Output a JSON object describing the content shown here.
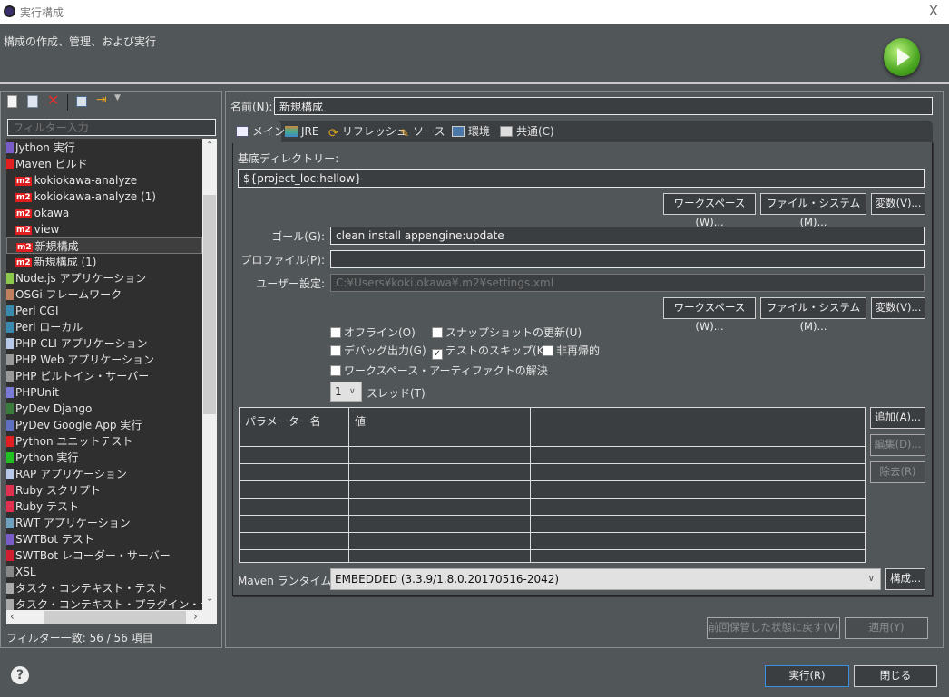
{
  "window": {
    "title": "実行構成",
    "close": "X"
  },
  "header": {
    "description": "構成の作成、管理、および実行"
  },
  "left": {
    "filter_placeholder": "フィルター入力",
    "items": [
      {
        "label": "Jython 実行",
        "type": "category",
        "icon": "jython-icon"
      },
      {
        "label": "Maven ビルド",
        "type": "category",
        "icon": "maven-icon"
      },
      {
        "label": "kokiokawa-analyze",
        "type": "child"
      },
      {
        "label": "kokiokawa-analyze (1)",
        "type": "child"
      },
      {
        "label": "okawa",
        "type": "child"
      },
      {
        "label": "view",
        "type": "child"
      },
      {
        "label": "新規構成",
        "type": "child",
        "selected": true
      },
      {
        "label": "新規構成 (1)",
        "type": "child"
      },
      {
        "label": "Node.js アプリケーション",
        "type": "category",
        "icon": "nodejs-icon"
      },
      {
        "label": "OSGi フレームワーク",
        "type": "category",
        "icon": "osgi-icon"
      },
      {
        "label": "Perl CGI",
        "type": "category",
        "icon": "perl-cgi-icon"
      },
      {
        "label": "Perl ローカル",
        "type": "category",
        "icon": "perl-icon"
      },
      {
        "label": "PHP CLI アプリケーション",
        "type": "category",
        "icon": "php-icon"
      },
      {
        "label": "PHP Web アプリケーション",
        "type": "category",
        "icon": "php-web-icon"
      },
      {
        "label": "PHP ビルトイン・サーバー",
        "type": "category",
        "icon": "php-server-icon"
      },
      {
        "label": "PHPUnit",
        "type": "category",
        "icon": "phpunit-icon"
      },
      {
        "label": "PyDev Django",
        "type": "category",
        "icon": "django-icon"
      },
      {
        "label": "PyDev Google App 実行",
        "type": "category",
        "icon": "google-app-icon"
      },
      {
        "label": "Python ユニットテスト",
        "type": "category",
        "icon": "python-unittest-icon"
      },
      {
        "label": "Python 実行",
        "type": "category",
        "icon": "python-icon"
      },
      {
        "label": "RAP アプリケーション",
        "type": "category",
        "icon": "rap-icon"
      },
      {
        "label": "Ruby スクリプト",
        "type": "category",
        "icon": "ruby-icon"
      },
      {
        "label": "Ruby テスト",
        "type": "category",
        "icon": "ruby-test-icon"
      },
      {
        "label": "RWT アプリケーション",
        "type": "category",
        "icon": "rwt-icon"
      },
      {
        "label": "SWTBot テスト",
        "type": "category",
        "icon": "swtbot-icon"
      },
      {
        "label": "SWTBot レコーダー・サーバー",
        "type": "category",
        "icon": "swtbot-recorder-icon"
      },
      {
        "label": "XSL",
        "type": "category",
        "icon": "xsl-icon"
      },
      {
        "label": "タスク・コンテキスト・テスト",
        "type": "category",
        "icon": "task-icon"
      },
      {
        "label": "タスク・コンテキスト・プラグイン・テスト",
        "type": "category",
        "icon": "task-plugin-icon"
      }
    ],
    "status": "フィルター一致: 56 / 56 項目"
  },
  "form": {
    "name_label": "名前(N):",
    "name_value": "新規構成",
    "tabs": [
      {
        "label": "メイン",
        "active": true
      },
      {
        "label": "JRE"
      },
      {
        "label": "リフレッシュ"
      },
      {
        "label": "ソース"
      },
      {
        "label": "環境"
      },
      {
        "label": "共通(C)"
      }
    ],
    "base_dir_label": "基底ディレクトリー:",
    "base_dir_value": "${project_loc:hellow}",
    "workspace_btn": "ワークスペース(W)...",
    "filesystem_btn": "ファイル・システム(M)...",
    "variables_btn": "変数(V)...",
    "goal_label": "ゴール(G):",
    "goal_value": "clean install appengine:update",
    "profile_label": "プロファイル(P):",
    "profile_value": "",
    "user_settings_label": "ユーザー設定:",
    "user_settings_placeholder": "C:¥Users¥koki.okawa¥.m2¥settings.xml",
    "checkboxes": [
      {
        "label": "オフライン(O)",
        "checked": false
      },
      {
        "label": "スナップショットの更新(U)",
        "checked": false
      },
      {
        "label": "デバッグ出力(G)",
        "checked": false
      },
      {
        "label": "テストのスキップ(K)",
        "checked": true
      },
      {
        "label": "非再帰的",
        "checked": false
      },
      {
        "label": "ワークスペース・アーティファクトの解決",
        "checked": false
      }
    ],
    "threads_value": "1",
    "threads_label": "スレッド(T)",
    "param_headers": [
      "パラメーター名",
      "値",
      ""
    ],
    "add_btn": "追加(A)...",
    "edit_btn": "編集(D)...",
    "remove_btn": "除去(R)",
    "runtime_label": "Maven ランタイム(I):",
    "runtime_value": "EMBEDDED (3.3.9/1.8.0.20170516-2042)",
    "configure_btn": "構成...",
    "revert_btn": "前回保管した状態に戻す(V)",
    "apply_btn": "適用(Y)"
  },
  "footer": {
    "run_btn": "実行(R)",
    "close_btn": "閉じる"
  }
}
